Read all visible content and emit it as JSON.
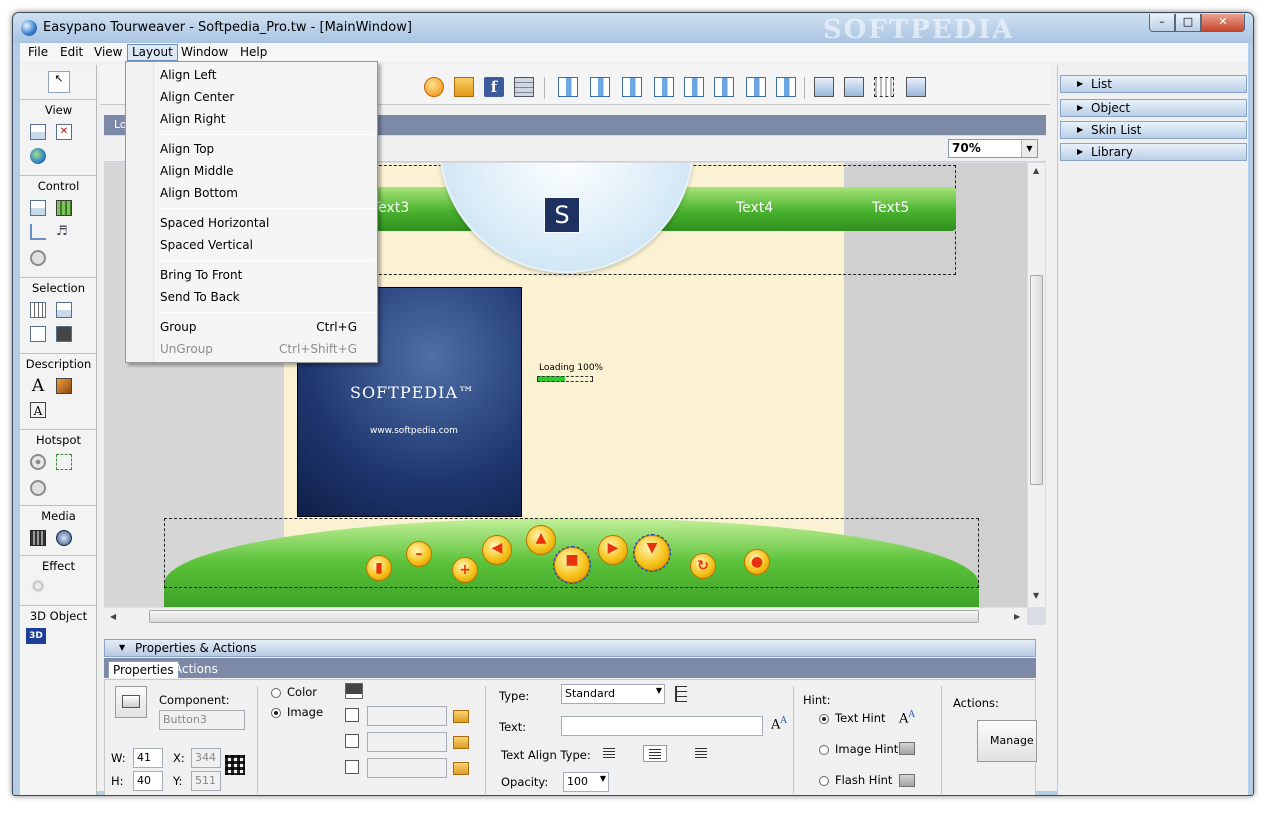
{
  "window": {
    "title": "Easypano Tourweaver - Softpedia_Pro.tw - [MainWindow]",
    "watermark": "SOFTPEDIA"
  },
  "menubar": [
    "File",
    "Edit",
    "View",
    "Layout",
    "Window",
    "Help"
  ],
  "layout_menu": {
    "items": [
      {
        "label": "Align Left",
        "shortcut": ""
      },
      {
        "label": "Align Center",
        "shortcut": ""
      },
      {
        "label": "Align Right",
        "shortcut": ""
      },
      {
        "label": "Align Top",
        "shortcut": ""
      },
      {
        "label": "Align Middle",
        "shortcut": ""
      },
      {
        "label": "Align Bottom",
        "shortcut": ""
      },
      {
        "label": "Spaced Horizontal",
        "shortcut": ""
      },
      {
        "label": "Spaced Vertical",
        "shortcut": ""
      },
      {
        "label": "Bring To Front",
        "shortcut": ""
      },
      {
        "label": "Send To Back",
        "shortcut": ""
      },
      {
        "label": "Group",
        "shortcut": "Ctrl+G"
      },
      {
        "label": "UnGroup",
        "shortcut": "Ctrl+Shift+G",
        "disabled": true
      }
    ]
  },
  "toolbox": {
    "sections": [
      "View",
      "Control",
      "Selection",
      "Description",
      "Hotspot",
      "Media",
      "Effect",
      "3D Object"
    ],
    "three_d_icon": "3D"
  },
  "doc": {
    "tab_label": "Lo",
    "zoom": "70%"
  },
  "canvas": {
    "nav_texts": [
      "Text3",
      "Text4",
      "Text5"
    ],
    "logo_letter": "S",
    "splash_brand": "SOFTPEDIA™",
    "splash_url": "www.softpedia.com",
    "loading": "Loading 100%",
    "loading_progress": 0.5
  },
  "right_panel": {
    "items": [
      "List",
      "Object",
      "Skin List",
      "Library"
    ]
  },
  "properties": {
    "header": "Properties & Actions",
    "tabs": [
      "Properties",
      "Actions"
    ],
    "component_label": "Component:",
    "component_value": "Button3",
    "w_label": "W:",
    "w_value": "41",
    "h_label": "H:",
    "h_value": "40",
    "x_label": "X:",
    "x_value": "344",
    "y_label": "Y:",
    "y_value": "511",
    "color_label": "Color",
    "image_label": "Image",
    "type_label": "Type:",
    "type_value": "Standard",
    "text_label": "Text:",
    "text_value": "",
    "text_align_label": "Text Align Type:",
    "opacity_label": "Opacity:",
    "opacity_value": "100",
    "hint_label": "Hint:",
    "hint_options": [
      "Text Hint",
      "Image Hint",
      "Flash Hint"
    ],
    "actions_label": "Actions:",
    "manage_button": "Manage A"
  }
}
